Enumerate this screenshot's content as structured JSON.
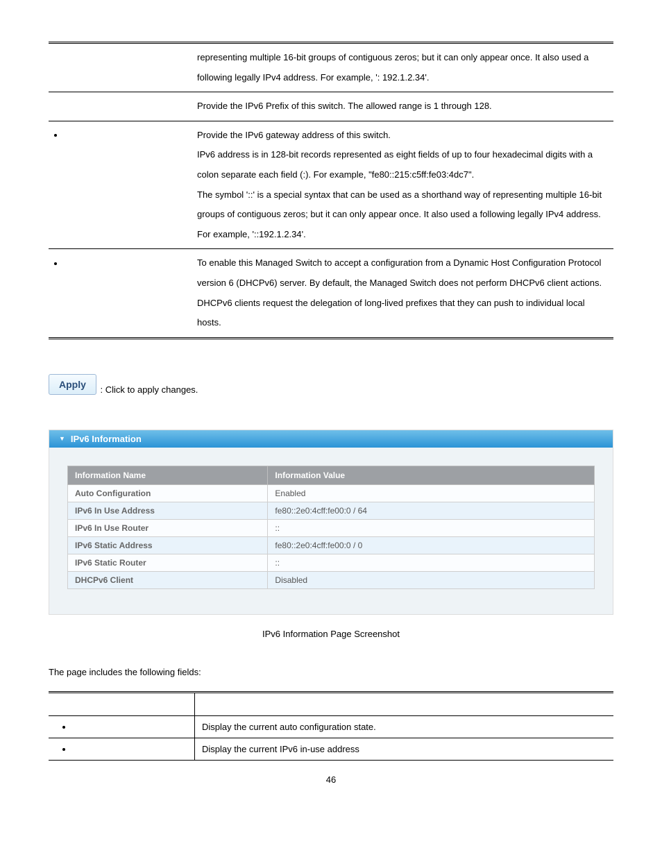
{
  "desc_rows": [
    {
      "bullet": false,
      "text": "representing multiple 16-bit groups of contiguous zeros; but it can only appear once. It also used a following legally IPv4 address. For example, ': 192.1.2.34'."
    },
    {
      "bullet": false,
      "text": "Provide the IPv6 Prefix of this switch. The allowed range is 1 through 128."
    },
    {
      "bullet": true,
      "text": "Provide the IPv6 gateway address of this switch.\nIPv6 address is in 128-bit records represented as eight fields of up to four hexadecimal digits with a colon separate each field (:). For example, \"fe80::215:c5ff:fe03:4dc7\".\nThe symbol '::' is a special syntax that can be used as a shorthand way of representing multiple 16-bit groups of contiguous zeros; but it can only appear once. It also used a following legally IPv4 address. For example, '::192.1.2.34'."
    },
    {
      "bullet": true,
      "text": "To enable this Managed Switch to accept a configuration from a Dynamic Host Configuration Protocol version 6 (DHCPv6) server. By default, the Managed Switch does not perform DHCPv6 client actions. DHCPv6 clients request the delegation of long-lived prefixes that they can push to individual local hosts."
    }
  ],
  "buttons": {
    "apply_label": "Apply",
    "apply_hint": ": Click to apply changes."
  },
  "panel": {
    "title": "IPv6 Information",
    "headers": {
      "c1": "Information Name",
      "c2": "Information Value"
    },
    "rows": [
      {
        "name": "Auto Configuration",
        "value": "Enabled"
      },
      {
        "name": "IPv6 In Use Address",
        "value": "fe80::2e0:4cff:fe00:0 / 64"
      },
      {
        "name": "IPv6 In Use Router",
        "value": "::"
      },
      {
        "name": "IPv6 Static Address",
        "value": "fe80::2e0:4cff:fe00:0 / 0"
      },
      {
        "name": "IPv6 Static Router",
        "value": "::"
      },
      {
        "name": "DHCPv6 Client",
        "value": "Disabled"
      }
    ]
  },
  "fig_caption": "IPv6 Information Page Screenshot",
  "fields_intro": "The page includes the following fields:",
  "fields_rows": [
    {
      "desc": "Display the current auto configuration state."
    },
    {
      "desc": "Display the current IPv6 in-use address"
    }
  ],
  "page_number": "46"
}
